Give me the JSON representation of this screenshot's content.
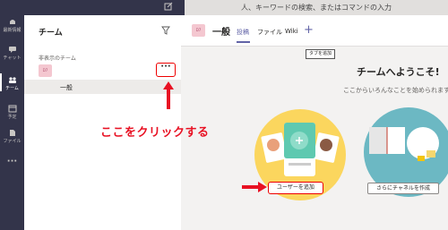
{
  "top": {
    "search_placeholder": "人、キーワードの検索、またはコマンドの入力"
  },
  "rail": {
    "items": [
      {
        "label": "最新情報",
        "icon": "bell-icon"
      },
      {
        "label": "チャット",
        "icon": "chat-icon"
      },
      {
        "label": "チーム",
        "icon": "teams-icon"
      },
      {
        "label": "予定",
        "icon": "calendar-icon"
      },
      {
        "label": "ファイル",
        "icon": "file-icon"
      },
      {
        "label": "···",
        "icon": "more-icon"
      }
    ]
  },
  "teams_panel": {
    "title": "チーム",
    "hidden_label": "非表示のチーム",
    "team_avatar_text": "D7",
    "more_label": "···",
    "channel": "一般"
  },
  "annotation": {
    "click_here": "ここをクリックする",
    "color": "#e81123"
  },
  "channel_header": {
    "avatar_text": "D7",
    "title": "一般",
    "tabs": [
      "投稿",
      "ファイル",
      "Wiki"
    ],
    "add_tab": "+",
    "tooltip": "タブを追加"
  },
  "welcome": {
    "title": "チームへようこそ!",
    "subtitle": "ここからいろんなことを始められます"
  },
  "buttons": {
    "add_user": "ユーザーを追加",
    "add_channel": "さらにチャネルを作成"
  },
  "colors": {
    "accent": "#6264a7",
    "rail": "#33344a"
  }
}
